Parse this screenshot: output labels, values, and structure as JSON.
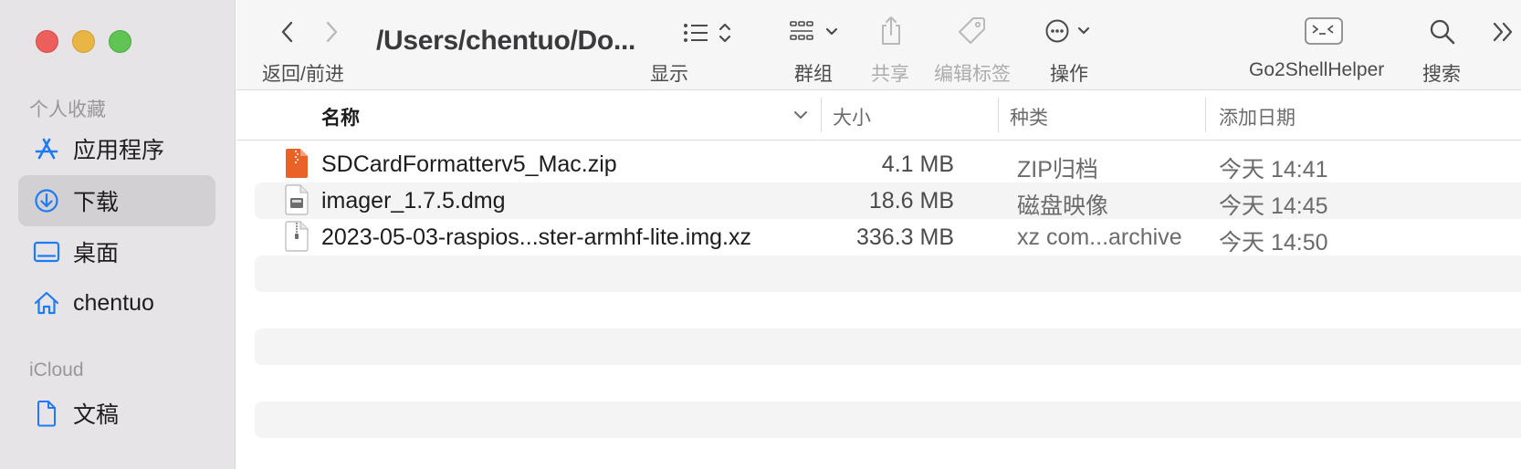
{
  "window": {
    "path_title": "/Users/chentuo/Do..."
  },
  "toolbar": {
    "nav_label": "返回/前进",
    "view_label": "显示",
    "group_label": "群组",
    "share_label": "共享",
    "tags_label": "编辑标签",
    "action_label": "操作",
    "go2shell_label": "Go2ShellHelper",
    "search_label": "搜索"
  },
  "sidebar": {
    "favorites_heading": "个人收藏",
    "icloud_heading": "iCloud",
    "items": [
      {
        "label": "应用程序",
        "icon": "app-store-icon"
      },
      {
        "label": "下载",
        "icon": "download-icon",
        "selected": true
      },
      {
        "label": "桌面",
        "icon": "desktop-icon"
      },
      {
        "label": "chentuo",
        "icon": "home-icon"
      }
    ],
    "icloud_items": [
      {
        "label": "文稿",
        "icon": "document-icon"
      }
    ]
  },
  "columns": {
    "name": "名称",
    "size": "大小",
    "kind": "种类",
    "date_added": "添加日期"
  },
  "files": [
    {
      "name": "SDCardFormatterv5_Mac.zip",
      "size": "4.1 MB",
      "kind": "ZIP归档",
      "date": "今天 14:41",
      "icon": "zip-icon"
    },
    {
      "name": "imager_1.7.5.dmg",
      "size": "18.6 MB",
      "kind": "磁盘映像",
      "date": "今天 14:45",
      "icon": "disk-image-icon"
    },
    {
      "name": "2023-05-03-raspios...ster-armhf-lite.img.xz",
      "size": "336.3 MB",
      "kind": "xz com...archive",
      "date": "今天 14:50",
      "icon": "archive-icon"
    }
  ],
  "colors": {
    "accent": "#1f7bf4",
    "close": "#ec5f5d",
    "minimize": "#e9b645",
    "zoom": "#5fc454",
    "zip": "#e8622a"
  }
}
